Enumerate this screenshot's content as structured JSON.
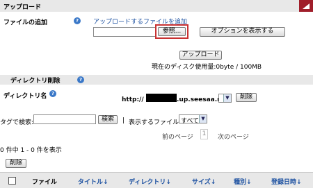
{
  "upload_section": {
    "title": "アップロード",
    "add_file_label": "ファイルの追加",
    "add_more_link": "アップロードするファイルを追加",
    "browse_label": "参照...",
    "options_label": "オプションを表示する",
    "upload_label": "アップロード",
    "disk_usage": "現在のディスク使用量:0byte / 100MB"
  },
  "dir_section": {
    "title": "ディレクトリ削除",
    "dir_name_label": "ディレクトリ名",
    "url_prefix": "http://",
    "url_suffix": ".up.seesaa.net/",
    "delete_label": "削除"
  },
  "search": {
    "tag_label": "タグで検索:",
    "search_button": "検索",
    "separator": "|",
    "filter_label": "表示するファイル",
    "filter_value": "すべて",
    "prev_page": "前のページ",
    "page_number": "1",
    "next_page": "次のページ"
  },
  "results": {
    "count_text": "0 件中 1 - 0 件を表示",
    "delete_label": "削除"
  },
  "table": {
    "headers": {
      "file": "ファイル",
      "title": "タイトル↓",
      "directory": "ディレクトリ↓",
      "size": "サイズ↓",
      "type": "種別↓",
      "registered": "登録日時↓"
    }
  },
  "colors": {
    "section_bg": "#e8e8e8",
    "link": "#1a4fa0",
    "highlight_border": "#c83232",
    "corner_icon": "#a01e2a"
  }
}
